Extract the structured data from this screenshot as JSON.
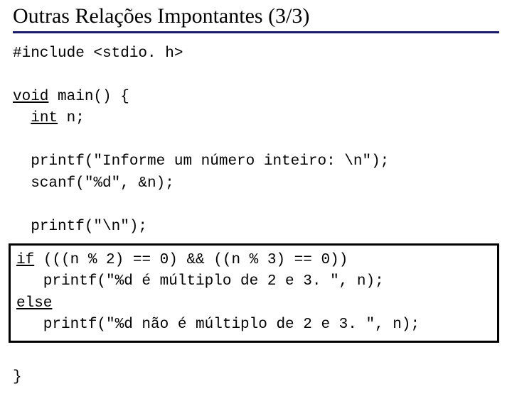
{
  "title": "Outras Relações Impontantes (3/3)",
  "code": {
    "l0": "#include <stdio. h>",
    "kw_void": "void",
    "l1_rest": " main() {",
    "kw_int": "int",
    "l2_rest": " n;",
    "l3": "  printf(\"Informe um número inteiro: \\n\");",
    "l4": "  scanf(\"%d\", &n);",
    "l5": "  printf(\"\\n\");",
    "kw_if": "if",
    "b1_rest": " (((n % 2) == 0) && ((n % 3) == 0))",
    "b2": "   printf(\"%d é múltiplo de 2 e 3. \", n);",
    "kw_else": "else",
    "b4": "   printf(\"%d não é múltiplo de 2 e 3. \", n);",
    "close": "}"
  }
}
